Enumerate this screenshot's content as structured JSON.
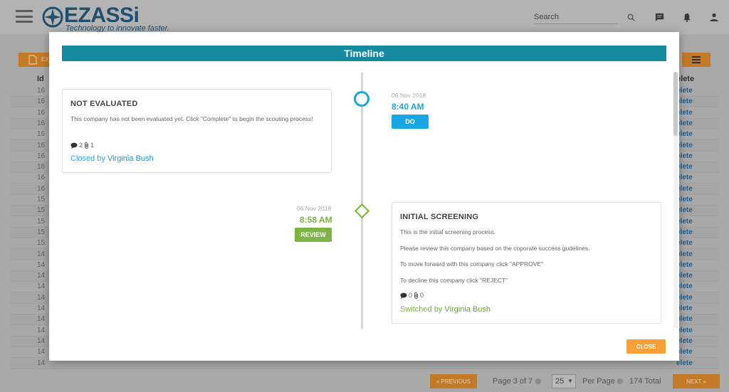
{
  "app": {
    "logo_text": "EZASSi",
    "tagline": "Technology to innovate faster.",
    "search_placeholder": "Search"
  },
  "background": {
    "export_label": "EX",
    "table_header": {
      "id": "Id",
      "delete": "elete"
    },
    "rows": [
      {
        "id": "16",
        "del": "elete"
      },
      {
        "id": "16",
        "del": "elete"
      },
      {
        "id": "16",
        "del": "elete"
      },
      {
        "id": "16",
        "del": "elete"
      },
      {
        "id": "16",
        "del": "elete"
      },
      {
        "id": "16",
        "del": "elete"
      },
      {
        "id": "16",
        "del": "elete"
      },
      {
        "id": "16",
        "del": "elete"
      },
      {
        "id": "16",
        "del": "elete"
      },
      {
        "id": "16",
        "del": "elete"
      },
      {
        "id": "15",
        "del": "elete"
      },
      {
        "id": "15",
        "del": "elete"
      },
      {
        "id": "15",
        "del": "elete"
      },
      {
        "id": "15",
        "del": "elete"
      },
      {
        "id": "15",
        "del": "elete"
      },
      {
        "id": "14",
        "del": "elete"
      },
      {
        "id": "14",
        "del": "elete"
      },
      {
        "id": "14",
        "del": "elete"
      },
      {
        "id": "14",
        "del": "elete"
      },
      {
        "id": "14",
        "del": "elete"
      },
      {
        "id": "14",
        "del": "elete"
      },
      {
        "id": "14",
        "del": "elete"
      },
      {
        "id": "14",
        "del": "elete"
      },
      {
        "id": "14",
        "del": "elete"
      },
      {
        "id": "14",
        "del": "elete"
      },
      {
        "id": "14",
        "del": "elete"
      }
    ],
    "pager": {
      "prev_label": "« PREVIOUS",
      "next_label": "NEXT »",
      "page_info": "Page 3 of 7",
      "per_page_value": "25",
      "per_page_label": "Per Page",
      "total": "174 Total"
    }
  },
  "modal": {
    "title": "Timeline",
    "close_label": "CLOSE",
    "events": [
      {
        "title": "NOT EVALUATED",
        "lines": [
          "This company has not been evaluated yet. Click \"Complete\" to begin the scouting process!"
        ],
        "comments": "2",
        "attachments": "1",
        "footer_prefix": "Closed by",
        "footer_user": "Virginia Bush",
        "date": "06 Nov 2018",
        "time": "8:40 AM",
        "action_label": "DO",
        "colors": {
          "accent": "#19a7e3"
        }
      },
      {
        "title": "INITIAL SCREENING",
        "lines": [
          "This is the initial screening process.",
          "Please review this company based on the coporate success gudelines.",
          "To move forward with this company click \"APPROVE\"",
          "To decline this company click \"REJECT\""
        ],
        "comments": "0",
        "attachments": "0",
        "footer_prefix": "Switched by",
        "footer_user": "Virginia Bush",
        "date": "06 Nov 2018",
        "time": "8:58 AM",
        "action_label": "REVIEW",
        "colors": {
          "accent": "#7cb342"
        }
      }
    ]
  },
  "colors": {
    "header_teal": "#168ba0",
    "close_orange": "#f7a035",
    "overlay_gray": "#a9a9a9"
  }
}
